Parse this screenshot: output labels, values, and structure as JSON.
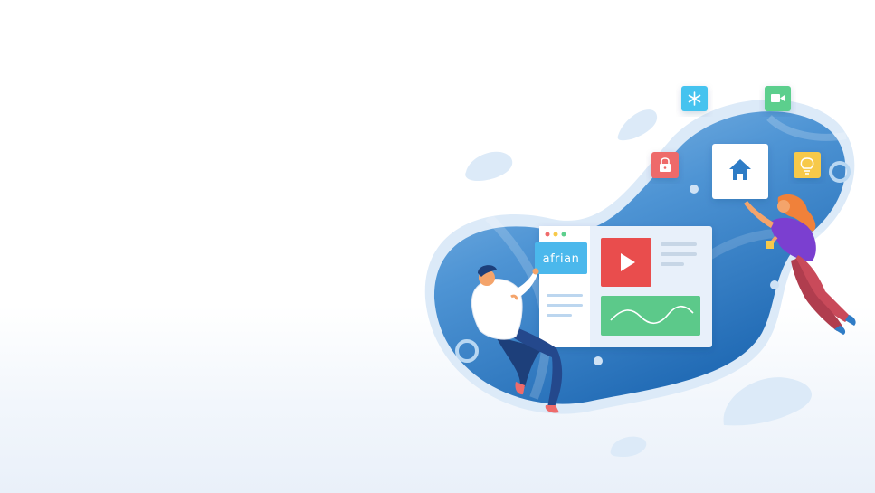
{
  "illustration": {
    "brand_label": "afrian",
    "icons": [
      "snowflake-icon",
      "video-camera-icon",
      "lock-icon",
      "home-icon",
      "lightbulb-icon",
      "play-icon"
    ],
    "colors": {
      "blob_light": "#dceaf8",
      "blob_dark": "#1f6fb8",
      "accent_blue": "#4bb8ec",
      "play_red": "#e94e4e",
      "chart_green": "#5cc98a",
      "lock_red": "#ee6b6b",
      "bulb_yellow": "#f7c94a",
      "snowflake_cyan": "#45c3ef",
      "video_green": "#5ccf8d"
    }
  }
}
